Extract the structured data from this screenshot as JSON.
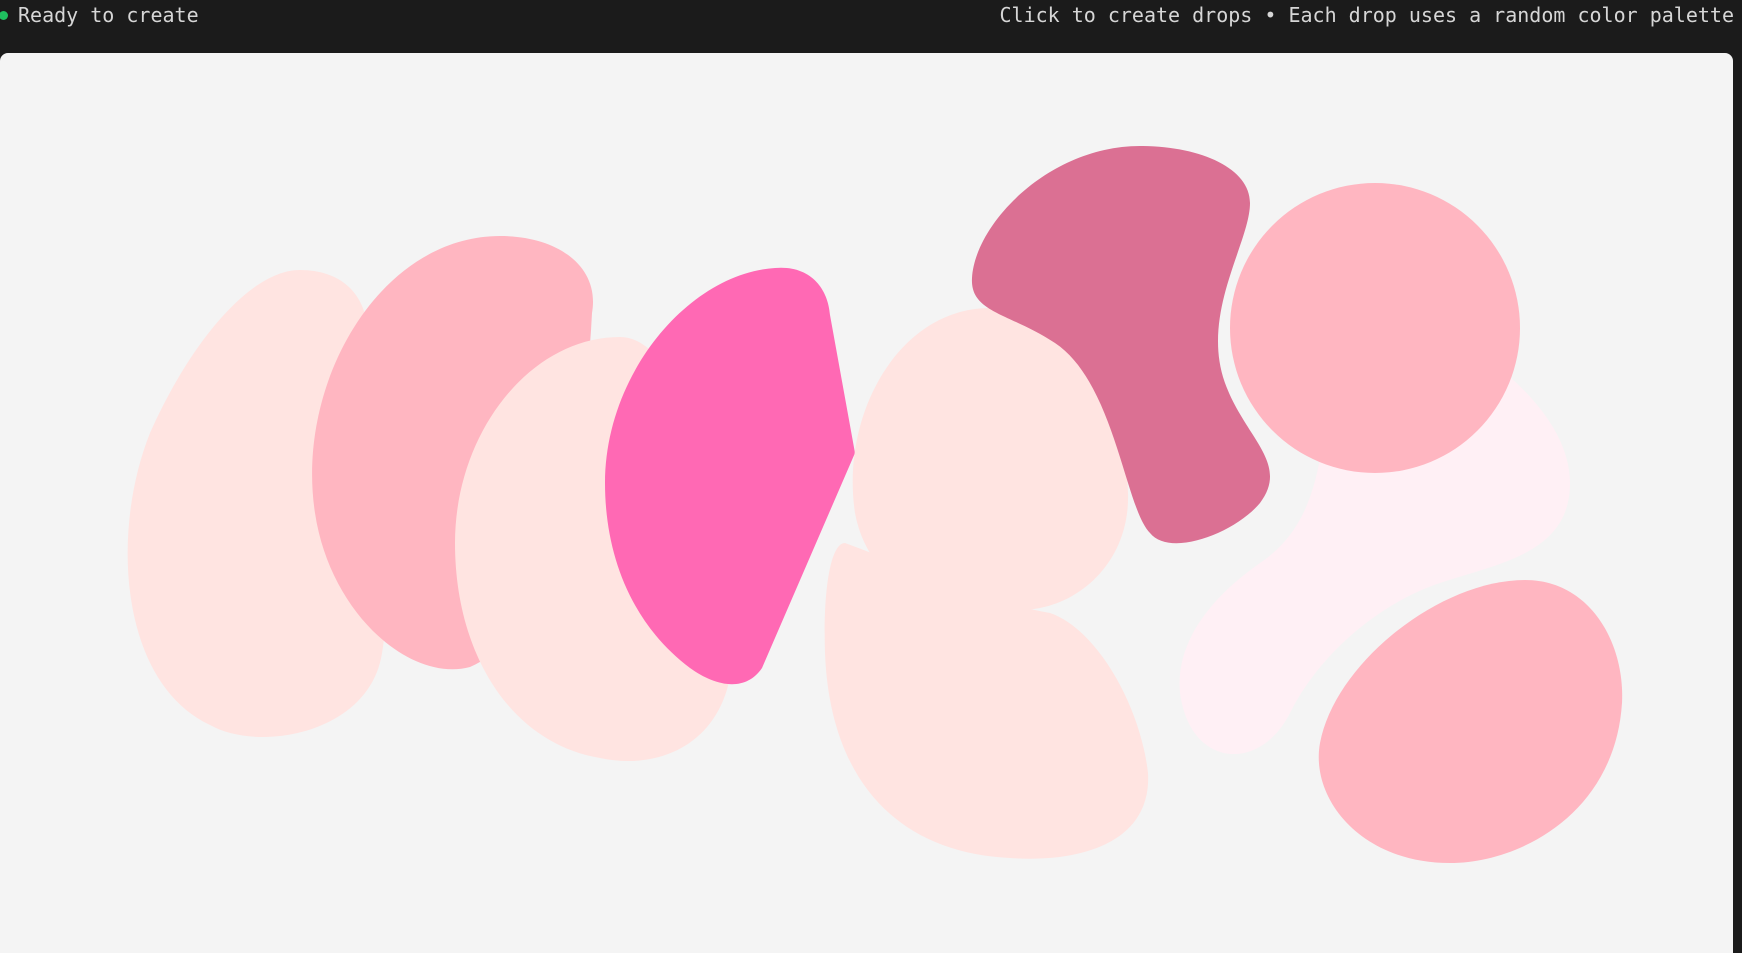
{
  "status": {
    "text": "Ready to create",
    "indicator_color": "#1fbf5f"
  },
  "hint": {
    "text": "Click to create drops • Each drop uses a random color palette"
  },
  "drops": [
    {
      "color": "#ffe4e1"
    },
    {
      "color": "#ffb6c1"
    },
    {
      "color": "#ffe4e1"
    },
    {
      "color": "#ff69b4"
    },
    {
      "color": "#ffe4e1"
    },
    {
      "color": "#db7093"
    },
    {
      "color": "#ffe4e1"
    },
    {
      "color": "#fff0f5"
    },
    {
      "color": "#ffb6c1"
    },
    {
      "color": "#ffb6c1"
    }
  ]
}
